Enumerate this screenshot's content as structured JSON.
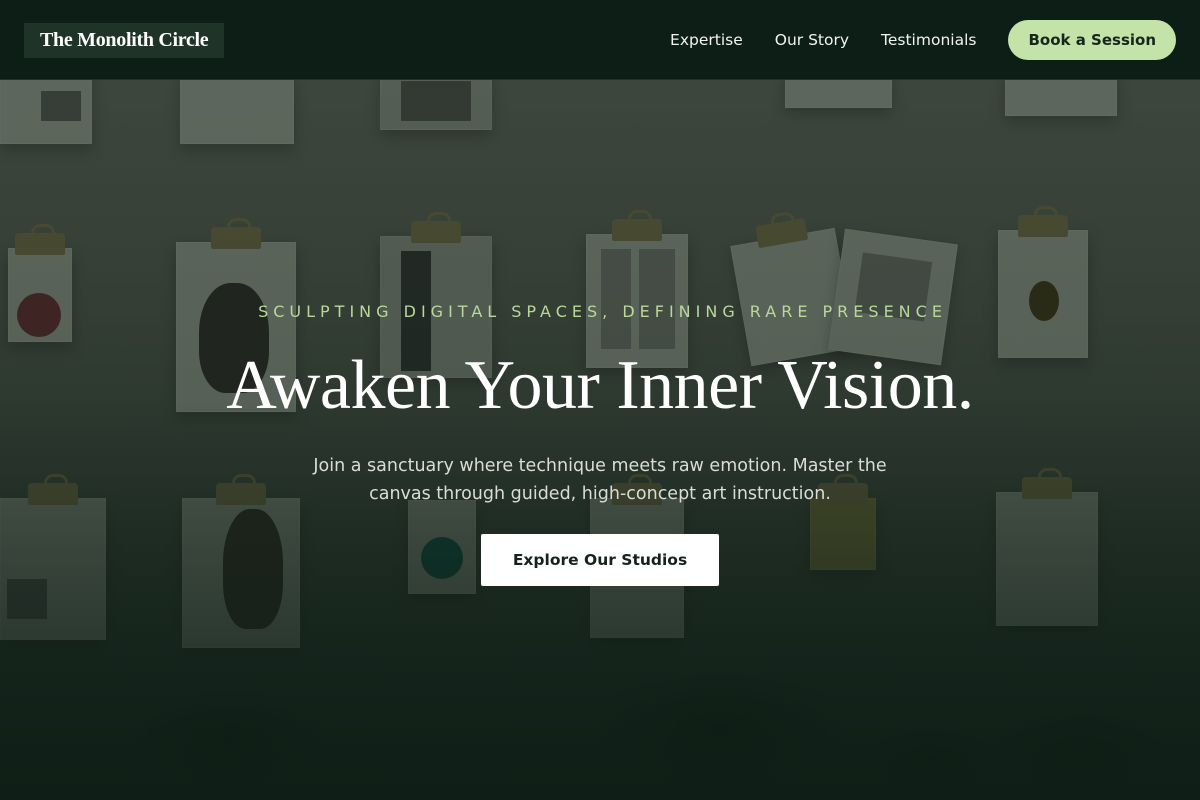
{
  "brand": {
    "name": "The Monolith Circle"
  },
  "nav": {
    "links": [
      "Expertise",
      "Our Story",
      "Testimonials"
    ],
    "cta_label": "Book a Session"
  },
  "hero": {
    "eyebrow": "SCULPTING DIGITAL SPACES, DEFINING RARE PRESENCE",
    "headline": "Awaken Your Inner Vision.",
    "subtext": "Join a sanctuary where technique meets raw emotion. Master the canvas through guided, high-concept art instruction.",
    "cta_label": "Explore Our Studios",
    "background_description_icon": "clipboard-gallery-wall-image"
  },
  "colors": {
    "header_bg": "#0d1e16",
    "accent": "#c4e3a8",
    "eyebrow": "#b9d89a",
    "cta_bg": "#ffffff"
  }
}
